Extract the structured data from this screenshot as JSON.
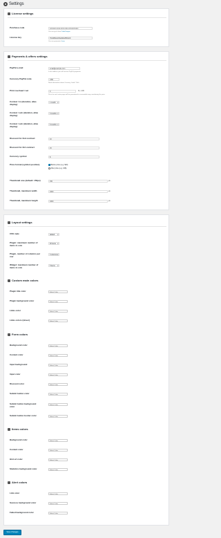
{
  "page": {
    "title": "Settings"
  },
  "license": {
    "title": "License settings",
    "purchase_code_label": "Purchase code",
    "purchase_code_value": "xxxxxxxx-xxxx-xxxx-xxxx-xxxxxxxxxxxx",
    "purchase_code_desc_pre": "You can get it from",
    "purchase_code_desc_link": "CodeCanyon",
    "license_key_label": "License key",
    "license_key_value": "7b2d0f9e4c81a6d3e5f0b2c9",
    "license_key_desc_pre": "You can generate it",
    "license_key_desc_link": "here"
  },
  "payments": {
    "title": "Payments & offers settings",
    "paypal_label": "PayPal e-mail",
    "paypal_value": "email@example.com",
    "paypal_desc": "Is the address you will receive PayPal payments",
    "currency_label": "Currency PayPal code",
    "currency_value": "USD",
    "currency_desc": "Need information about Currency Code? Click",
    "print_label": "Print overload / net",
    "print_value": "0",
    "print_unit": "%, 1.00",
    "print_desc": "Price for each extra page will be guaranteed in reasonable way considering the price",
    "contest1_label": "Contest / to (duration, alias display)",
    "contest1_value": "1 month",
    "contest2_label": "Contest / sub (duration, alias display)",
    "contest2_value": "3 months",
    "contest3_label": "Contest / sub (duration, alias display)",
    "contest3_value": "6 months",
    "discount1_label": "Discount for 2nd contract",
    "discount1_value": "10",
    "discount2_label": "Discount for 3rd contract",
    "discount2_value": "15",
    "currency_symbol_label": "Currency symbol",
    "currency_symbol_value": "$",
    "price_format_label": "Price format (symbol position)",
    "price_format_opt1": "Before price (e.g. $10)",
    "price_format_opt2": "After price (e.g. 10$)",
    "thumb_label": "Thumbnail size (default: 150px)",
    "thumb_value": "150",
    "thumb_unit": "px",
    "thumb_w_label": "Thumbnail, maximum width",
    "thumb_w_value": "1600",
    "thumb_w_unit": "px",
    "thumb_h_label": "Thumbnail, maximum height",
    "thumb_h_value": "1600",
    "thumb_h_unit": "px"
  },
  "layout": {
    "title": "Layout settings",
    "css_label": "CSS style",
    "css_value": "default",
    "plugin_max_label": "Plugin: maximum number of items in cols",
    "plugin_max_value": "20 items",
    "columns_label": "Plugin, number of columns per row",
    "columns_value": "3 columns",
    "widget_label": "Widget: maximum number of items in cols",
    "widget_value": "5 items"
  },
  "color_btn": "Select Color",
  "main_colors": {
    "title": "Custom main colors",
    "items": [
      "Plugin title color",
      "Plugin background color",
      "Links color",
      "Links colors (Hover)"
    ]
  },
  "form_colors": {
    "title": "Form colors",
    "items": [
      "Background color",
      "Content color",
      "Input background",
      "Input color",
      "Discount color",
      "Submit button color",
      "Submit button background color",
      "Submit button border color"
    ]
  },
  "items_colors": {
    "title": "Items colors",
    "items": [
      "Background color",
      "Content color",
      "Hint url color",
      "Statistics background color"
    ]
  },
  "alert_colors": {
    "title": "Alert colors",
    "items": [
      "Link color",
      "Success background color",
      "Failed background color"
    ]
  },
  "save_label": "Save Changes"
}
